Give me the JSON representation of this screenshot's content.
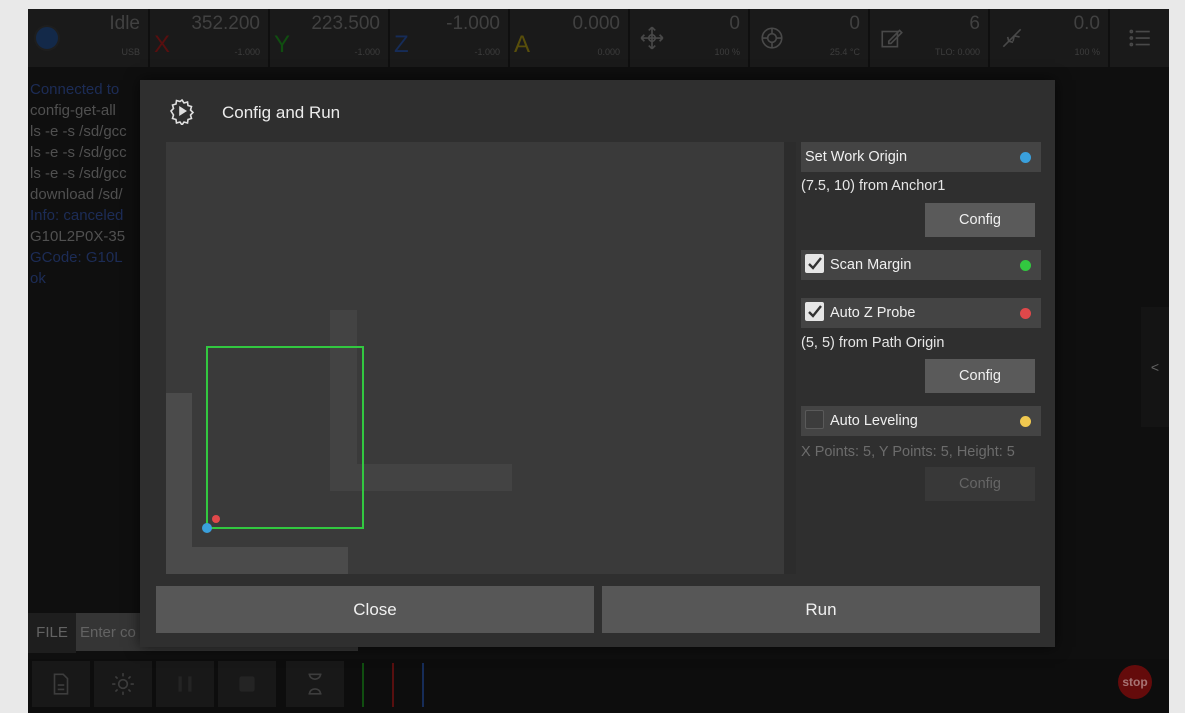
{
  "status": {
    "state": "Idle",
    "connection": "USB"
  },
  "axes": [
    {
      "letter": "X",
      "value": "352.200",
      "sub": "-1.000",
      "color": "#7a1515"
    },
    {
      "letter": "Y",
      "value": "223.500",
      "sub": "-1.000",
      "color": "#176d17"
    },
    {
      "letter": "Z",
      "value": "-1.000",
      "sub": "-1.000",
      "color": "#1f3d7a"
    },
    {
      "letter": "A",
      "value": "0.000",
      "sub": "0.000",
      "color": "#7a6d10"
    }
  ],
  "metrics": {
    "jog": {
      "value": "0",
      "sub": "100 %"
    },
    "spindle": {
      "value": "0",
      "sub": "25.4 °C"
    },
    "tool": {
      "value": "6",
      "sub": "TLO: 0.000"
    },
    "laser": {
      "value": "0.0",
      "sub": "100 %"
    }
  },
  "console": [
    {
      "text": "Connected to",
      "kind": "info"
    },
    {
      "text": "config-get-all",
      "kind": "cmd"
    },
    {
      "text": "ls -e -s /sd/gcc",
      "kind": "cmd"
    },
    {
      "text": "ls -e -s /sd/gcc",
      "kind": "cmd"
    },
    {
      "text": "ls -e -s /sd/gcc",
      "kind": "cmd"
    },
    {
      "text": "download /sd/",
      "kind": "cmd"
    },
    {
      "text": "Info: canceled",
      "kind": "info"
    },
    {
      "text": "G10L2P0X-35",
      "kind": "cmd"
    },
    {
      "text": "GCode: G10L",
      "kind": "info"
    },
    {
      "text": "ok",
      "kind": "info"
    }
  ],
  "file_bar": {
    "file_label": "FILE",
    "input_placeholder": "Enter co"
  },
  "side_toggle": "<",
  "toolbar": {
    "stop_label": "stop",
    "line_colors": [
      "#176d17",
      "#7a1515",
      "#1f3d7a"
    ]
  },
  "modal": {
    "title": "Config and Run",
    "sections": {
      "work_origin": {
        "label": "Set Work Origin",
        "dot_color": "#3aa0dc",
        "info": "(7.5, 10) from Anchor1",
        "button": "Config"
      },
      "scan_margin": {
        "label": "Scan Margin",
        "checked": true,
        "dot_color": "#32c840"
      },
      "auto_z": {
        "label": "Auto Z Probe",
        "checked": true,
        "dot_color": "#e0484a",
        "info": "(5, 5) from Path Origin",
        "button": "Config"
      },
      "auto_level": {
        "label": "Auto Leveling",
        "checked": false,
        "dot_color": "#f0c850",
        "info": "X Points: 5, Y Points: 5, Height: 5",
        "button": "Config"
      }
    },
    "close_label": "Close",
    "run_label": "Run"
  }
}
